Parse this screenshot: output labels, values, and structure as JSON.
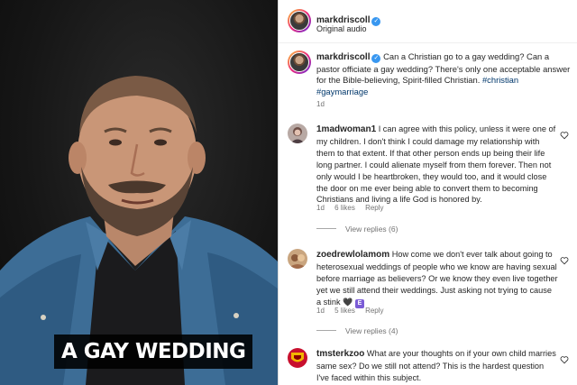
{
  "video": {
    "caption": "A GAY WEDDING"
  },
  "post": {
    "username": "markdriscoll",
    "audio": "Original audio",
    "caption_username": "markdriscoll",
    "caption_text": "Can a Christian go to a gay wedding? Can a pastor officiate a gay wedding? There's only one acceptable answer for the Bible-believing, Spirit-filled Christian.",
    "hashtags": "#christian #gaymarriage",
    "time": "1d"
  },
  "comments": [
    {
      "username": "1madwoman1",
      "text": "I can agree with this policy, unless it were one of my children. I don't think I could damage my relationship with them to that extent. If that other person ends up being their life long partner. I could alienate myself from them forever. Then not only would I be heartbroken, they would too, and it would close the door on me ever being able to convert them to becoming Christians and living a life God is honored by.",
      "time": "1d",
      "likes": "6 likes",
      "reply": "Reply",
      "view_replies": "View replies (6)"
    },
    {
      "username": "zoedrewlolamom",
      "text": "How come we don't ever talk about going to heterosexual weddings of people who we know are having sexual before marriage as believers? Or we know they even live together yet we still attend their weddings. Just asking not trying to cause a stink",
      "time": "1d",
      "likes": "5 likes",
      "reply": "Reply",
      "view_replies": "View replies (4)",
      "emoji_1": "🖤",
      "emoji_2": "E"
    },
    {
      "username": "tmsterkzoo",
      "text": "What are your thoughts on if your own child marries same sex? Do we still not attend? This is the hardest question I've faced within this subject."
    }
  ],
  "colors": {
    "link": "#00376b",
    "muted": "#737373",
    "verified": "#3897f0"
  }
}
